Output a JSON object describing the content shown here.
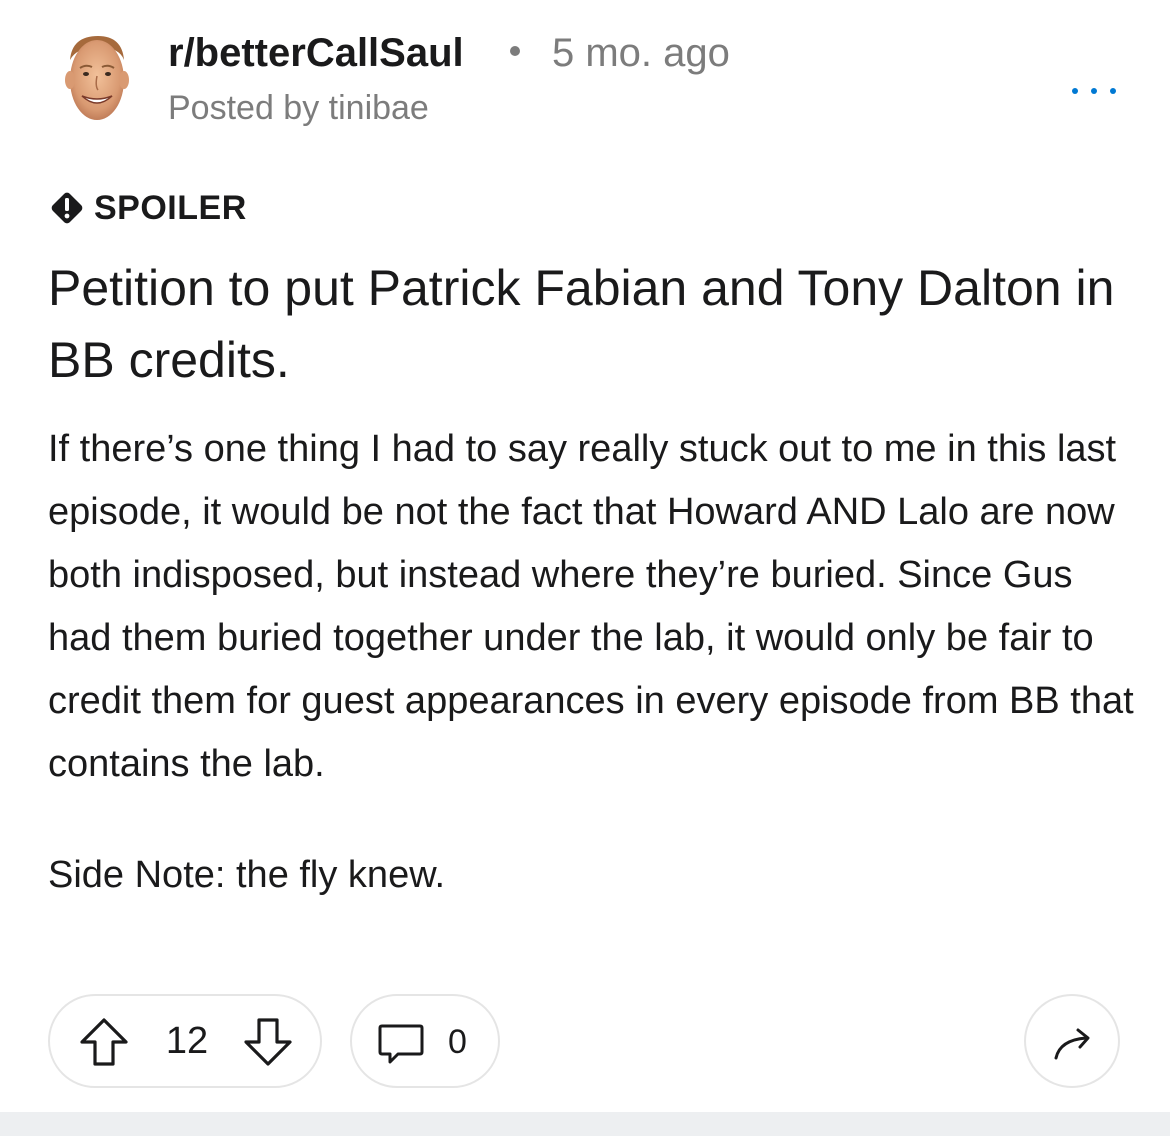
{
  "header": {
    "subreddit": "r/betterCallSaul",
    "timestamp": "5 mo. ago",
    "posted_by": "Posted by tinibae",
    "avatar_icon": "subreddit-avatar-face",
    "more_icon": "more-dots-icon"
  },
  "post": {
    "flair": "SPOILER",
    "flair_icon": "alert-diamond-icon",
    "title": "Petition to put Patrick Fabian and Tony Dalton in BB credits.",
    "body": [
      "If there’s one thing I had to say really stuck out to me in this last episode, it would be not the fact that Howard AND Lalo are now both indisposed, but instead where they’re buried. Since Gus had them buried together under the lab, it would only be fair to credit them for guest appearances in every episode from BB that contains the lab.",
      "Side Note: the fly knew."
    ]
  },
  "actions": {
    "vote_count": "12",
    "comment_count": "0",
    "upvote_icon": "upvote-arrow-icon",
    "downvote_icon": "downvote-arrow-icon",
    "comment_icon": "comment-bubble-icon",
    "share_icon": "share-arrow-icon"
  },
  "colors": {
    "text": "#1a1a1b",
    "meta": "#7c7c7c",
    "accent": "#0079d3",
    "border": "#e5e5e5",
    "background_strip": "#edeff1"
  }
}
